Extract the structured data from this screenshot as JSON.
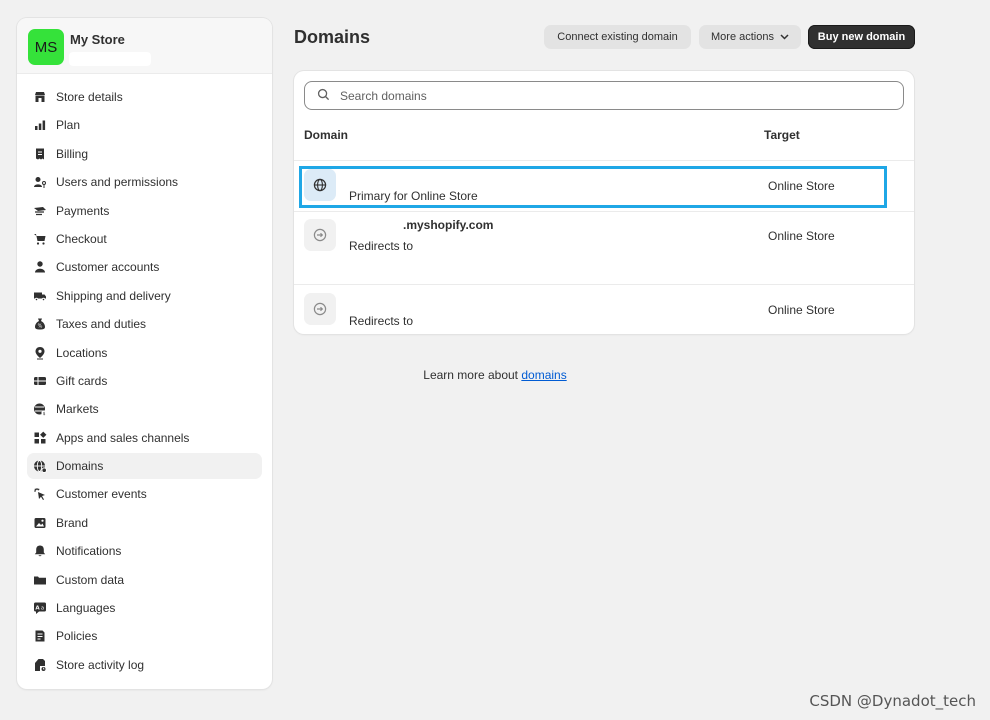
{
  "store": {
    "initials": "MS",
    "name": "My Store",
    "avatar_color": "#35e23a"
  },
  "sidebar": {
    "items": [
      {
        "label": "Store details",
        "icon": "store-icon"
      },
      {
        "label": "Plan",
        "icon": "plan-chart-icon"
      },
      {
        "label": "Billing",
        "icon": "billing-receipt-icon"
      },
      {
        "label": "Users and permissions",
        "icon": "users-key-icon"
      },
      {
        "label": "Payments",
        "icon": "payments-icon"
      },
      {
        "label": "Checkout",
        "icon": "cart-icon"
      },
      {
        "label": "Customer accounts",
        "icon": "person-icon"
      },
      {
        "label": "Shipping and delivery",
        "icon": "truck-icon"
      },
      {
        "label": "Taxes and duties",
        "icon": "tax-bag-icon"
      },
      {
        "label": "Locations",
        "icon": "location-pin-icon"
      },
      {
        "label": "Gift cards",
        "icon": "gift-card-icon"
      },
      {
        "label": "Markets",
        "icon": "globe-dollar-icon"
      },
      {
        "label": "Apps and sales channels",
        "icon": "apps-grid-icon"
      },
      {
        "label": "Domains",
        "icon": "globe-icon",
        "active": true
      },
      {
        "label": "Customer events",
        "icon": "cursor-click-icon"
      },
      {
        "label": "Brand",
        "icon": "brand-image-icon"
      },
      {
        "label": "Notifications",
        "icon": "bell-icon"
      },
      {
        "label": "Custom data",
        "icon": "folder-icon"
      },
      {
        "label": "Languages",
        "icon": "language-icon"
      },
      {
        "label": "Policies",
        "icon": "policy-document-icon"
      },
      {
        "label": "Store activity log",
        "icon": "activity-log-icon"
      }
    ]
  },
  "header": {
    "title": "Domains",
    "connect_label": "Connect existing domain",
    "more_label": "More actions",
    "buy_label": "Buy new domain"
  },
  "domains": {
    "search_placeholder": "Search domains",
    "columns": {
      "domain": "Domain",
      "target": "Target"
    },
    "rows": [
      {
        "name": "",
        "subtitle": "Primary for Online Store",
        "target": "Online Store",
        "icon": "globe-icon"
      },
      {
        "name": ".myshopify.com",
        "subtitle": "Redirects to",
        "target": "Online Store",
        "icon": "globe-redirect-icon"
      },
      {
        "name": "",
        "subtitle": "Redirects to",
        "target": "Online Store",
        "icon": "globe-redirect-icon"
      }
    ]
  },
  "footer": {
    "learn_prefix": "Learn more about ",
    "learn_link": "domains"
  },
  "watermark": "CSDN @Dynadot_tech",
  "colors": {
    "highlight": "#1fa7e6",
    "link": "#005bd3",
    "primary_button": "#303030"
  }
}
